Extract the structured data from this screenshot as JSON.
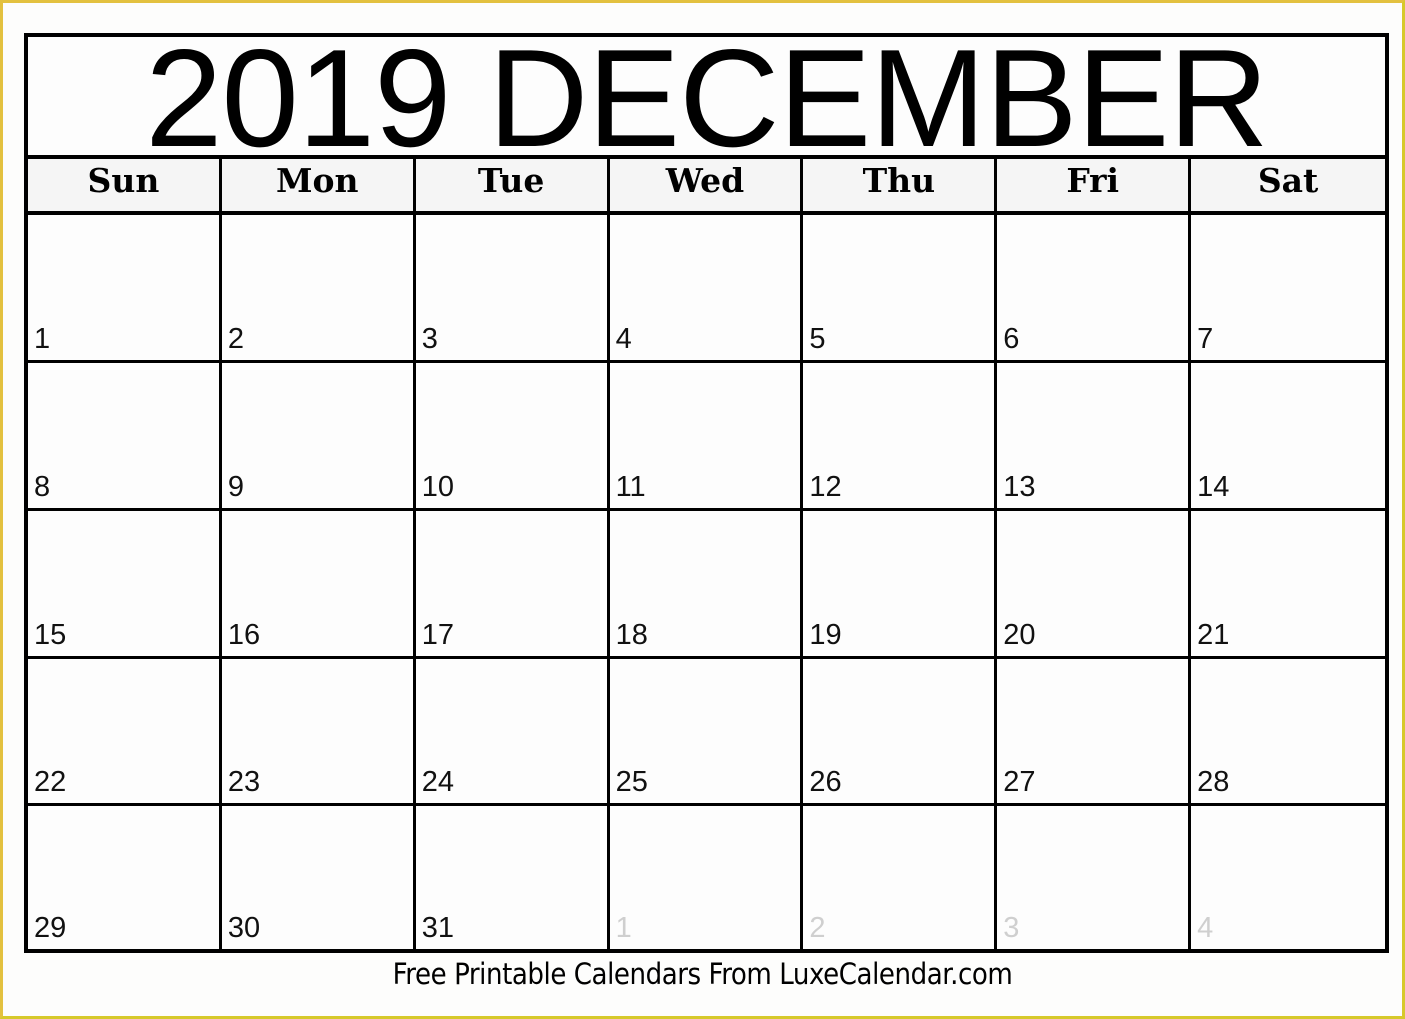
{
  "calendar": {
    "title": "2019 DECEMBER",
    "weekdays": [
      "Sun",
      "Mon",
      "Tue",
      "Wed",
      "Thu",
      "Fri",
      "Sat"
    ],
    "weeks": [
      [
        {
          "day": "1",
          "current": true
        },
        {
          "day": "2",
          "current": true
        },
        {
          "day": "3",
          "current": true
        },
        {
          "day": "4",
          "current": true
        },
        {
          "day": "5",
          "current": true
        },
        {
          "day": "6",
          "current": true
        },
        {
          "day": "7",
          "current": true
        }
      ],
      [
        {
          "day": "8",
          "current": true
        },
        {
          "day": "9",
          "current": true
        },
        {
          "day": "10",
          "current": true
        },
        {
          "day": "11",
          "current": true
        },
        {
          "day": "12",
          "current": true
        },
        {
          "day": "13",
          "current": true
        },
        {
          "day": "14",
          "current": true
        }
      ],
      [
        {
          "day": "15",
          "current": true
        },
        {
          "day": "16",
          "current": true
        },
        {
          "day": "17",
          "current": true
        },
        {
          "day": "18",
          "current": true
        },
        {
          "day": "19",
          "current": true
        },
        {
          "day": "20",
          "current": true
        },
        {
          "day": "21",
          "current": true
        }
      ],
      [
        {
          "day": "22",
          "current": true
        },
        {
          "day": "23",
          "current": true
        },
        {
          "day": "24",
          "current": true
        },
        {
          "day": "25",
          "current": true
        },
        {
          "day": "26",
          "current": true
        },
        {
          "day": "27",
          "current": true
        },
        {
          "day": "28",
          "current": true
        }
      ],
      [
        {
          "day": "29",
          "current": true
        },
        {
          "day": "30",
          "current": true
        },
        {
          "day": "31",
          "current": true
        },
        {
          "day": "1",
          "current": false
        },
        {
          "day": "2",
          "current": false
        },
        {
          "day": "3",
          "current": false
        },
        {
          "day": "4",
          "current": false
        }
      ]
    ]
  },
  "footer": {
    "text": "Free Printable Calendars From LuxeCalendar.com"
  },
  "colors": {
    "frame_border": "#e3c13f",
    "grid_lines": "#000000",
    "header_bg": "#f5f5f5",
    "other_month_text": "#cfcfcf"
  }
}
